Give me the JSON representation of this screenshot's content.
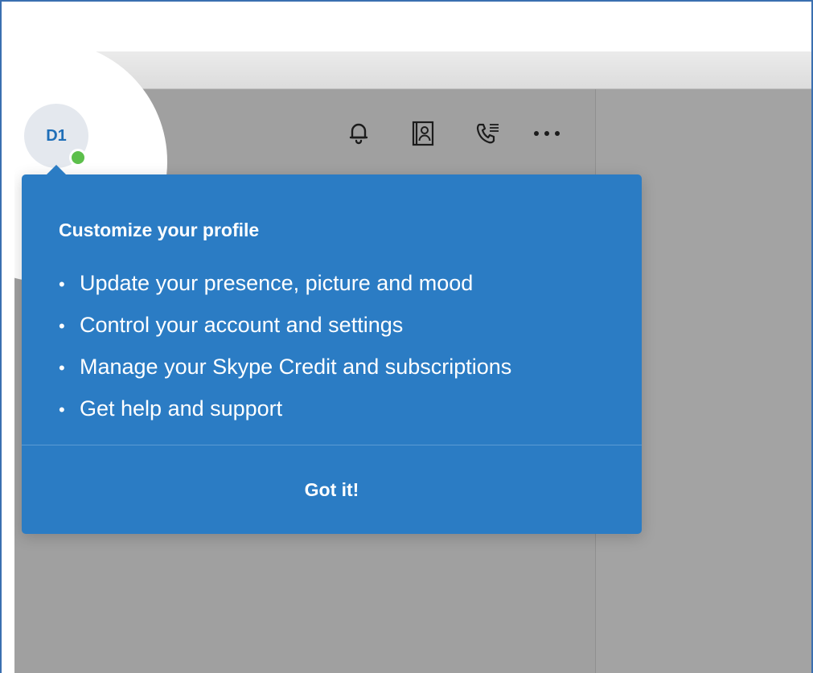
{
  "window": {
    "controls": [
      "close",
      "minimize",
      "maximize"
    ]
  },
  "profile": {
    "initials": "D1",
    "presence": "online"
  },
  "toolbar": {
    "icons": [
      "bell-icon",
      "contacts-icon",
      "call-list-icon",
      "more-icon"
    ]
  },
  "popover": {
    "title": "Customize your profile",
    "items": [
      "Update your presence, picture and mood",
      "Control your account and settings",
      "Manage your Skype Credit and subscriptions",
      "Get help and support"
    ],
    "button_label": "Got it!"
  },
  "colors": {
    "popover_bg": "#2b7cc4",
    "avatar_text": "#1f6fb8",
    "presence_online": "#5cbf4b",
    "traffic_close": "#fc5753",
    "traffic_min": "#fdbc40",
    "traffic_max": "#33c748"
  }
}
